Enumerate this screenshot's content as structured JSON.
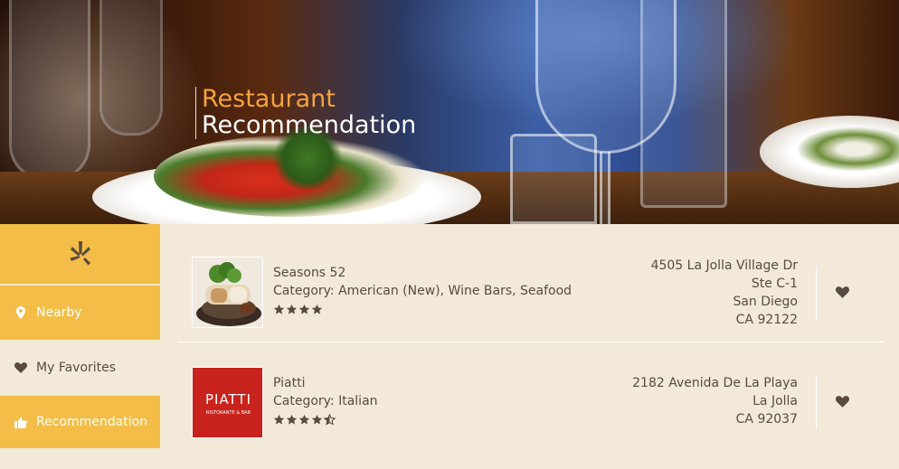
{
  "hero": {
    "title_line1": "Restaurant",
    "title_line2": "Recommendation"
  },
  "sidebar": {
    "logo_icon": "yelp-burst-icon",
    "items": [
      {
        "label": "Nearby",
        "icon": "map-pin-icon",
        "active": true
      },
      {
        "label": "My Favorites",
        "icon": "heart-icon",
        "active": false
      },
      {
        "label": "Recommendation",
        "icon": "thumbs-up-icon",
        "active": true
      }
    ]
  },
  "restaurants": [
    {
      "name": "Seasons 52",
      "category": "Category: American (New), Wine Bars, Seafood",
      "rating": 4,
      "address_line1": "4505 La Jolla Village Dr",
      "address_line2": "Ste C-1",
      "city": "San Diego",
      "state_zip": "CA 92122"
    },
    {
      "name": "Piatti",
      "category": "Category: Italian",
      "rating": 4.5,
      "logo_text": "PIATTI",
      "logo_subtext": "RISTORANTE & BAR",
      "address_line1": "2182 Avenida De La Playa",
      "city": "La Jolla",
      "state_zip": "CA 92037"
    }
  ],
  "colors": {
    "accent": "#f3bd47",
    "title_accent": "#f5a33f",
    "panel_bg": "#f3e9d9",
    "text": "#5a4a3f",
    "piatti_red": "#c8231c"
  }
}
